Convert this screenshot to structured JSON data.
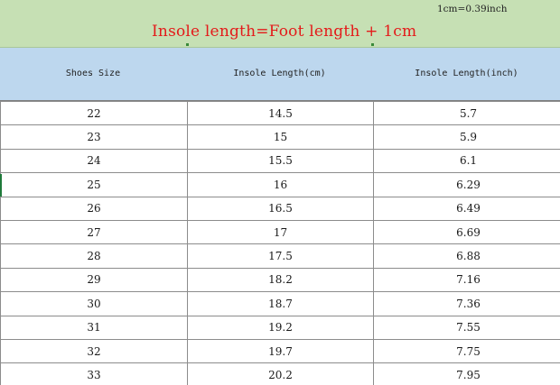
{
  "banner": {
    "conversion_note": "1cm=0.39inch",
    "headline": "Insole length=Foot length + 1cm"
  },
  "table": {
    "headers": [
      "Shoes Size",
      "Insole Length(cm)",
      "Insole Length(inch)"
    ],
    "rows": [
      [
        "22",
        "14.5",
        "5.7"
      ],
      [
        "23",
        "15",
        "5.9"
      ],
      [
        "24",
        "15.5",
        "6.1"
      ],
      [
        "25",
        "16",
        "6.29"
      ],
      [
        "26",
        "16.5",
        "6.49"
      ],
      [
        "27",
        "17",
        "6.69"
      ],
      [
        "28",
        "17.5",
        "6.88"
      ],
      [
        "29",
        "18.2",
        "7.16"
      ],
      [
        "30",
        "18.7",
        "7.36"
      ],
      [
        "31",
        "19.2",
        "7.55"
      ],
      [
        "32",
        "19.7",
        "7.75"
      ],
      [
        "33",
        "20.2",
        "7.95"
      ]
    ]
  },
  "colors": {
    "banner_bg": "#c6e0b4",
    "header_bg": "#bdd7ee",
    "headline": "#e41a1a"
  }
}
